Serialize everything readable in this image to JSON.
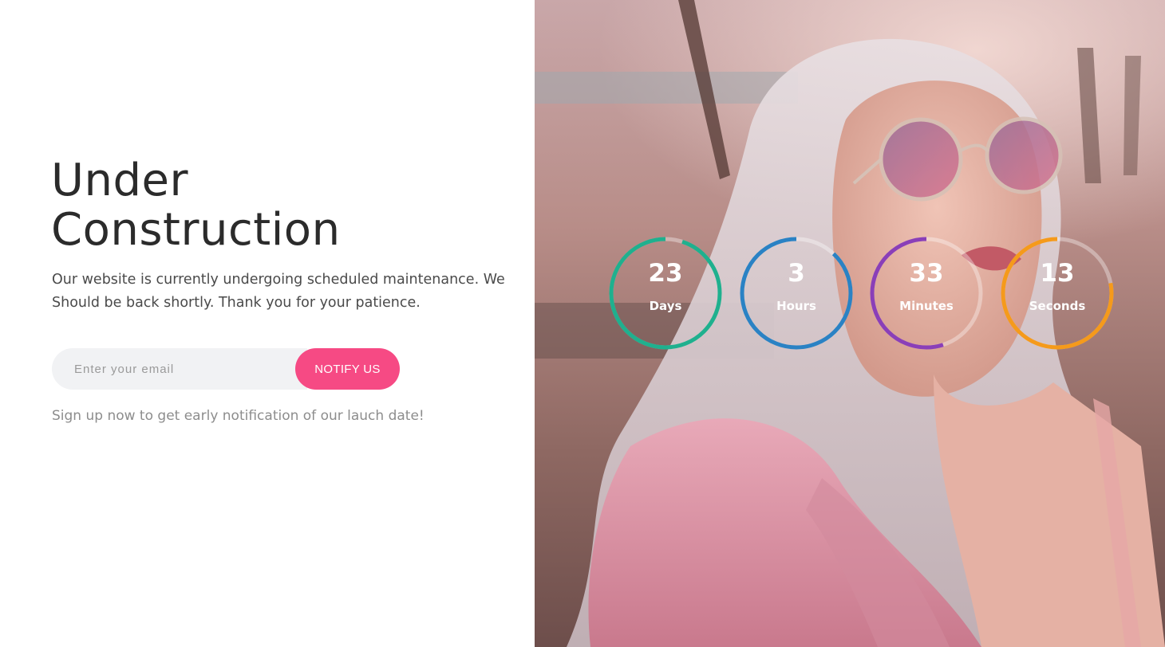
{
  "hero": {
    "title_line1": "Under",
    "title_line2": "Construction",
    "description": "Our website is currently undergoing scheduled maintenance. We Should be back shortly. Thank you for your patience."
  },
  "subscribe": {
    "email_placeholder": "Enter your email",
    "email_value": "",
    "button_label": "NOTIFY US",
    "note": "Sign up now to get early notification of our lauch date!"
  },
  "countdown": [
    {
      "value": "23",
      "unit": "Days",
      "color": "#1fb08e",
      "progress": 0.95
    },
    {
      "value": "3",
      "unit": "Hours",
      "color": "#2a82c4",
      "progress": 0.88
    },
    {
      "value": "33",
      "unit": "Minutes",
      "color": "#8a3fb8",
      "progress": 0.55
    },
    {
      "value": "13",
      "unit": "Seconds",
      "color": "#f59a1b",
      "progress": 0.78
    }
  ],
  "colors": {
    "accent": "#f64a84",
    "title": "#2b2b2b",
    "ring_track": "rgba(255,255,255,0.35)"
  }
}
